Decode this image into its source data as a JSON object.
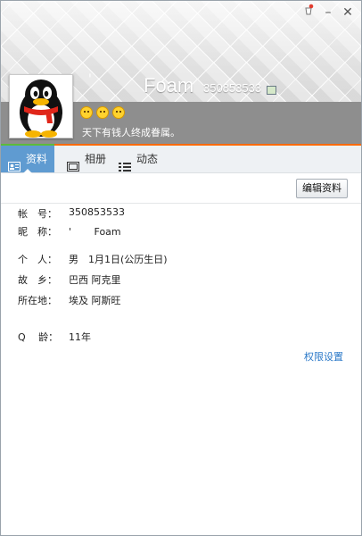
{
  "profile": {
    "apostrophe": "'",
    "nickname": "Foam",
    "qq_number": "350853533",
    "signature": "天下有钱人终成眷属。"
  },
  "tabs": [
    {
      "label": "资料",
      "active": true
    },
    {
      "label": "相册",
      "active": false
    },
    {
      "label": "动态",
      "active": false
    }
  ],
  "edit_button": "编辑资料",
  "info": {
    "account_label": "帐　号：",
    "account_value": "350853533",
    "nickname_label": "昵　称：",
    "nickname_value": "'　　 Foam",
    "personal_label": "个　人：",
    "personal_value": "男　1月1日(公历生日)",
    "hometown_label": "故　乡：",
    "hometown_value": "巴西 阿克里",
    "location_label": "所在地：",
    "location_value": "埃及 阿斯旺",
    "age_label": "Q　 龄：",
    "age_value": "11年"
  },
  "permission_link": "权限设置",
  "window_controls": {
    "minimize": "–",
    "close": "✕"
  },
  "colors": {
    "tab_active": "#5f9bd1",
    "link": "#2a78c8",
    "accent_stripe": "#ff6a00",
    "band": "#8e8e8e"
  }
}
